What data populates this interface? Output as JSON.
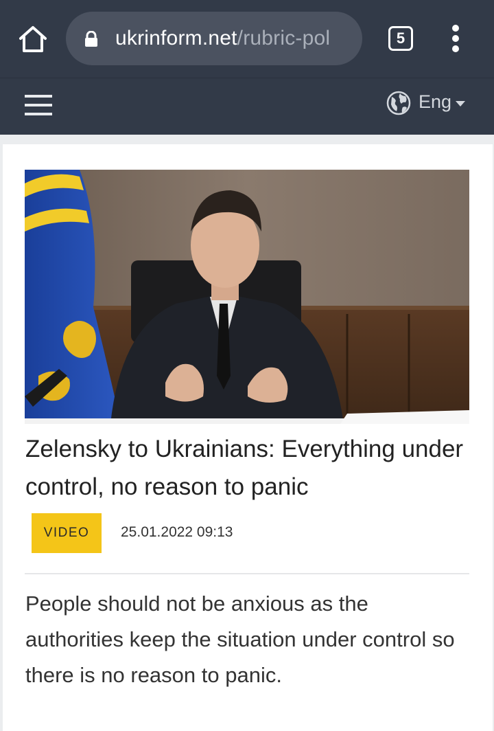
{
  "browser": {
    "home_icon": "home-icon",
    "lock_icon": "lock-icon",
    "url_domain": "ukrinform.net",
    "url_path": "/rubric-pol",
    "tab_count": "5",
    "menu_icon": "overflow-menu-icon"
  },
  "site_header": {
    "menu_icon": "hamburger-icon",
    "language_icon": "globe-icon",
    "language": "Eng"
  },
  "article": {
    "headline": "Zelensky to Ukrainians: Everything under control, no reason to panic",
    "badge": "VIDEO",
    "datetime": "25.01.2022 09:13",
    "lead": "People should not be anxious as the authorities keep the situation under control so there is no reason to panic."
  },
  "colors": {
    "header_bg": "#323a48",
    "badge_bg": "#f4c518",
    "card_bg": "#ffffff"
  }
}
